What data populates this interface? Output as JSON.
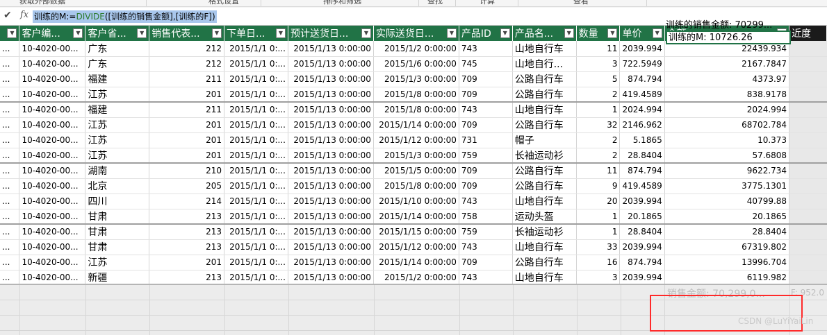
{
  "ribbon": {
    "groups": [
      "获取外部数据",
      "格式设置",
      "排序和筛选",
      "查找",
      "计算",
      "查看"
    ]
  },
  "formula_bar": {
    "check_icon": "check-icon",
    "fx_label": "fx",
    "formula_prefix": "训练的M:=",
    "formula_fn": "DIVIDE",
    "formula_args": "([训练的销售金额],[训练的F])"
  },
  "table": {
    "headers": [
      "",
      "客户编...",
      "客户省...",
      "销售代表...",
      "下单日...",
      "预计送货日...",
      "实际送货日...",
      "产品ID",
      "产品名...",
      "数量",
      "单价",
      "金额",
      "近度"
    ],
    "rows": [
      [
        "...",
        "10-4020-00...",
        "广东",
        "212",
        "2015/1/1 0:...",
        "2015/1/13 0:00:00",
        "2015/1/2 0:00:00",
        "743",
        "山地自行车",
        "11",
        "2039.994",
        "22439.934",
        ""
      ],
      [
        "...",
        "10-4020-00...",
        "广东",
        "212",
        "2015/1/1 0:...",
        "2015/1/13 0:00:00",
        "2015/1/6 0:00:00",
        "745",
        "山地自行...",
        "3",
        "722.5949",
        "2167.7847",
        ""
      ],
      [
        "...",
        "10-4020-00...",
        "福建",
        "211",
        "2015/1/1 0:...",
        "2015/1/13 0:00:00",
        "2015/1/3 0:00:00",
        "709",
        "公路自行车",
        "5",
        "874.794",
        "4373.97",
        ""
      ],
      [
        "...",
        "10-4020-00...",
        "江苏",
        "201",
        "2015/1/1 0:...",
        "2015/1/13 0:00:00",
        "2015/1/8 0:00:00",
        "709",
        "公路自行车",
        "2",
        "419.4589",
        "838.9178",
        ""
      ],
      [
        "...",
        "10-4020-00...",
        "福建",
        "211",
        "2015/1/1 0:...",
        "2015/1/13 0:00:00",
        "2015/1/8 0:00:00",
        "743",
        "山地自行车",
        "1",
        "2024.994",
        "2024.994",
        ""
      ],
      [
        "...",
        "10-4020-00...",
        "江苏",
        "201",
        "2015/1/1 0:...",
        "2015/1/13 0:00:00",
        "2015/1/14 0:00:00",
        "709",
        "公路自行车",
        "32",
        "2146.962",
        "68702.784",
        ""
      ],
      [
        "...",
        "10-4020-00...",
        "江苏",
        "201",
        "2015/1/1 0:...",
        "2015/1/13 0:00:00",
        "2015/1/12 0:00:00",
        "731",
        "帽子",
        "2",
        "5.1865",
        "10.373",
        ""
      ],
      [
        "...",
        "10-4020-00...",
        "江苏",
        "201",
        "2015/1/1 0:...",
        "2015/1/13 0:00:00",
        "2015/1/3 0:00:00",
        "759",
        "长袖运动衫",
        "2",
        "28.8404",
        "57.6808",
        ""
      ],
      [
        "...",
        "10-4020-00...",
        "湖南",
        "210",
        "2015/1/1 0:...",
        "2015/1/13 0:00:00",
        "2015/1/5 0:00:00",
        "709",
        "公路自行车",
        "11",
        "874.794",
        "9622.734",
        ""
      ],
      [
        "...",
        "10-4020-00...",
        "北京",
        "205",
        "2015/1/1 0:...",
        "2015/1/13 0:00:00",
        "2015/1/8 0:00:00",
        "709",
        "公路自行车",
        "9",
        "419.4589",
        "3775.1301",
        ""
      ],
      [
        "...",
        "10-4020-00...",
        "四川",
        "214",
        "2015/1/1 0:...",
        "2015/1/13 0:00:00",
        "2015/1/10 0:00:00",
        "743",
        "山地自行车",
        "20",
        "2039.994",
        "40799.88",
        ""
      ],
      [
        "...",
        "10-4020-00...",
        "甘肃",
        "213",
        "2015/1/1 0:...",
        "2015/1/13 0:00:00",
        "2015/1/14 0:00:00",
        "758",
        "运动头盔",
        "1",
        "20.1865",
        "20.1865",
        ""
      ],
      [
        "...",
        "10-4020-00...",
        "甘肃",
        "213",
        "2015/1/1 0:...",
        "2015/1/13 0:00:00",
        "2015/1/15 0:00:00",
        "759",
        "长袖运动衫",
        "1",
        "28.8404",
        "28.8404",
        ""
      ],
      [
        "...",
        "10-4020-00...",
        "甘肃",
        "213",
        "2015/1/1 0:...",
        "2015/1/13 0:00:00",
        "2015/1/12 0:00:00",
        "743",
        "山地自行车",
        "33",
        "2039.994",
        "67319.802",
        ""
      ],
      [
        "...",
        "10-4020-00...",
        "江苏",
        "201",
        "2015/1/1 0:...",
        "2015/1/13 0:00:00",
        "2015/1/14 0:00:00",
        "709",
        "公路自行车",
        "16",
        "874.794",
        "13996.704",
        ""
      ],
      [
        "...",
        "10-4020-00...",
        "新疆",
        "213",
        "2015/1/1 0:...",
        "2015/1/13 0:00:00",
        "2015/1/2 0:00:00",
        "743",
        "山地自行车",
        "3",
        "2039.994",
        "6119.982",
        ""
      ]
    ]
  },
  "calc_area": {
    "ghost_measure": "销售金额: 70,299,0...",
    "ghost_right": "F: 952.0",
    "measure_1": "训练的销售金额: 70299...",
    "measure_2": "训练的M: 10726.26"
  },
  "watermark": "CSDN @LuYiYaiLin",
  "colors": {
    "header_bg": "#217346",
    "formula_highlight": "#a9c7ec",
    "annotation_box": "#ff2a2a"
  }
}
